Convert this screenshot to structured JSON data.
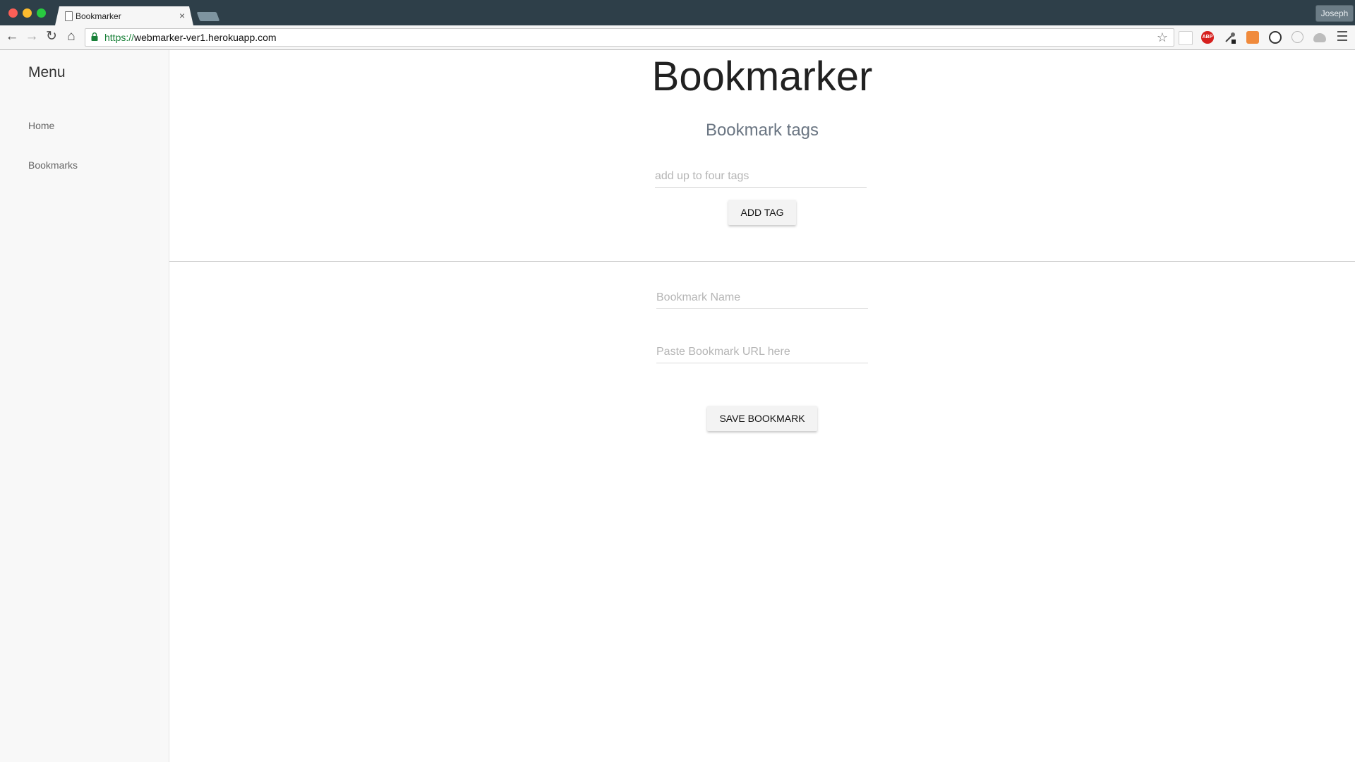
{
  "browser": {
    "tab_title": "Bookmarker",
    "tab_close": "×",
    "profile_name": "Joseph",
    "url_scheme": "https://",
    "url_host": "webmarker-ver1.herokuapp.com",
    "nav_back": "←",
    "nav_forward": "→",
    "nav_reload": "↻",
    "nav_home": "⌂",
    "bookmark_star": "☆",
    "extensions": [
      "calendar-icon",
      "adblock-icon",
      "eyedropper-icon",
      "fox-icon",
      "panda-icon",
      "circle-icon",
      "cloud-icon"
    ],
    "adblock_label": "ABP"
  },
  "sidebar": {
    "title": "Menu",
    "items": [
      {
        "label": "Home"
      },
      {
        "label": "Bookmarks"
      }
    ]
  },
  "main": {
    "title": "Bookmarker",
    "tags_heading": "Bookmark tags",
    "tag_input_placeholder": "add up to four tags",
    "add_tag_button": "ADD TAG",
    "name_placeholder": "Bookmark Name",
    "url_placeholder": "Paste Bookmark URL here",
    "save_button": "SAVE BOOKMARK"
  },
  "colors": {
    "chrome_dark": "#2e3f49",
    "url_scheme": "#188038",
    "heading_gray": "#6a7582"
  }
}
